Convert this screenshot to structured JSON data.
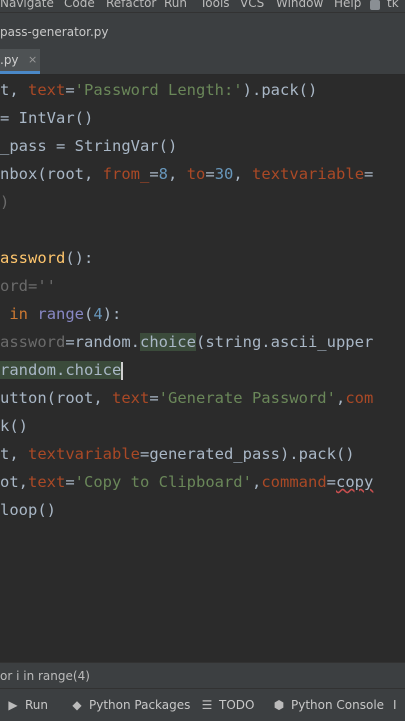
{
  "menu": {
    "items": [
      "Navigate",
      "Code",
      "Refactor",
      "Run",
      "Tools",
      "VCS",
      "Window",
      "Help"
    ],
    "overflow": "tk"
  },
  "breadcrumb": {
    "file": "pass-generator.py"
  },
  "tab": {
    "label": ".py",
    "close": "×"
  },
  "editor": {
    "lines": [
      [
        {
          "t": "t, "
        },
        {
          "t": "text",
          "c": "param"
        },
        {
          "t": "="
        },
        {
          "t": "'Password Length:'",
          "c": "str"
        },
        {
          "t": ").pack()"
        }
      ],
      [
        {
          "t": "= IntVar()"
        }
      ],
      [
        {
          "t": "_pass = StringVar()"
        }
      ],
      [
        {
          "t": "nbox(root, "
        },
        {
          "t": "from_",
          "c": "param"
        },
        {
          "t": "="
        },
        {
          "t": "8",
          "c": "num"
        },
        {
          "t": ", "
        },
        {
          "t": "to",
          "c": "param"
        },
        {
          "t": "="
        },
        {
          "t": "30",
          "c": "num"
        },
        {
          "t": ", "
        },
        {
          "t": "textvariable",
          "c": "param"
        },
        {
          "t": "="
        }
      ],
      [
        {
          "t": ")",
          "c": "dim"
        }
      ],
      [],
      [
        {
          "t": "assword",
          "c": "fn"
        },
        {
          "t": "():"
        }
      ],
      [
        {
          "t": "ord=''",
          "c": "dim"
        }
      ],
      [
        {
          "t": " "
        },
        {
          "t": "in",
          "c": "kw"
        },
        {
          "t": " "
        },
        {
          "t": "range",
          "c": "bi"
        },
        {
          "t": "("
        },
        {
          "t": "4",
          "c": "num"
        },
        {
          "t": "):"
        }
      ],
      [
        {
          "t": "assword",
          "c": "dim"
        },
        {
          "t": "=random."
        },
        {
          "t": "choice",
          "c": "hl"
        },
        {
          "t": "(string.ascii_upper"
        }
      ],
      [
        {
          "t": "random.choice",
          "c": "hl"
        },
        {
          "t": "",
          "c": "caret"
        }
      ],
      [
        {
          "t": "utton(root, "
        },
        {
          "t": "text",
          "c": "param"
        },
        {
          "t": "="
        },
        {
          "t": "'Generate Password'",
          "c": "str"
        },
        {
          "t": ","
        },
        {
          "t": "com",
          "c": "param"
        }
      ],
      [
        {
          "t": "k()"
        }
      ],
      [
        {
          "t": "t, "
        },
        {
          "t": "textvariable",
          "c": "param"
        },
        {
          "t": "=generated_pass).pack()"
        }
      ],
      [
        {
          "t": "ot,"
        },
        {
          "t": "text",
          "c": "param"
        },
        {
          "t": "="
        },
        {
          "t": "'Copy to Clipboard'",
          "c": "str"
        },
        {
          "t": ","
        },
        {
          "t": "command",
          "c": "param"
        },
        {
          "t": "="
        },
        {
          "t": "copy",
          "c": "und"
        }
      ],
      [
        {
          "t": "loop()"
        }
      ]
    ]
  },
  "status": {
    "context": "or i in range(4)"
  },
  "toolbar": {
    "run": "Run",
    "packages": "Python Packages",
    "todo": "TODO",
    "console": "Python Console",
    "overflow": "I"
  },
  "icons": {
    "run": "play-icon",
    "packages": "layers-icon",
    "todo": "list-icon",
    "console": "python-icon"
  }
}
